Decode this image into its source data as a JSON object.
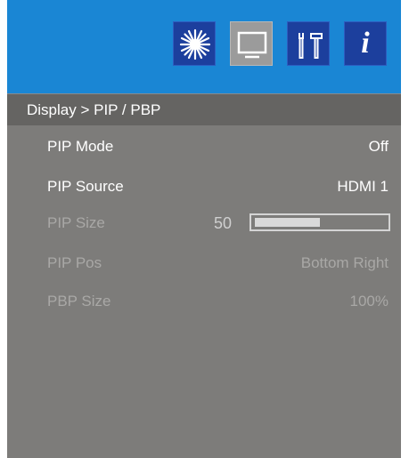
{
  "tabs": [
    {
      "name": "picture-tab",
      "icon": "sun-icon",
      "active": false
    },
    {
      "name": "display-tab",
      "icon": "monitor-icon",
      "active": true
    },
    {
      "name": "setup-tab",
      "icon": "tools-icon",
      "active": false
    },
    {
      "name": "info-tab",
      "icon": "info-icon",
      "label": "i",
      "active": false
    }
  ],
  "breadcrumb": "Display > PIP / PBP",
  "menu": {
    "pip_mode": {
      "label": "PIP Mode",
      "value": "Off",
      "enabled": true
    },
    "pip_source": {
      "label": "PIP Source",
      "value": "HDMI 1",
      "enabled": true
    },
    "pip_size": {
      "label": "PIP Size",
      "value": "50",
      "level": 0.5,
      "enabled": false
    },
    "pip_pos": {
      "label": "PIP Pos",
      "value": "Bottom Right",
      "enabled": false
    },
    "pbp_size": {
      "label": "PBP Size",
      "value": "100%",
      "enabled": false
    }
  },
  "colors": {
    "header": "#1a86d4",
    "tab": "#1c3f9d",
    "tab_active": "#9b9b9b",
    "panel": "#7d7c7a",
    "breadcrumb_bar": "#656462",
    "enabled_text": "#ffffff",
    "disabled_text": "#a9a8a6"
  }
}
